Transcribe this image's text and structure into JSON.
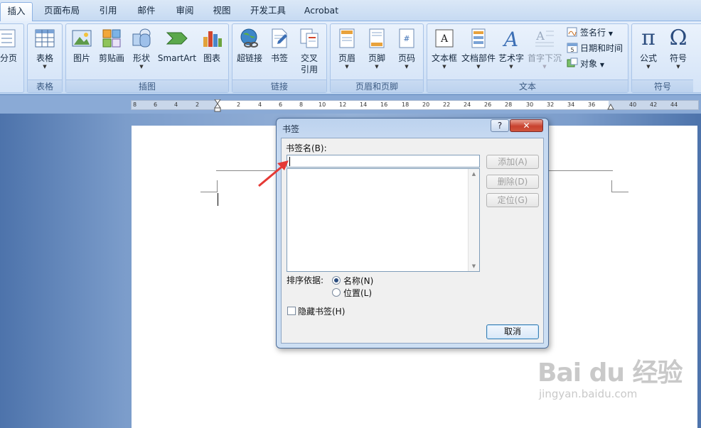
{
  "tabs": [
    {
      "label": "插入",
      "active": true
    },
    {
      "label": "页面布局"
    },
    {
      "label": "引用"
    },
    {
      "label": "邮件"
    },
    {
      "label": "审阅"
    },
    {
      "label": "视图"
    },
    {
      "label": "开发工具"
    },
    {
      "label": "Acrobat"
    }
  ],
  "ribbon": {
    "pages_partial_label": "分页",
    "groups": {
      "table": {
        "label": "表格",
        "buttons": {
          "table": "表格"
        }
      },
      "illustrations": {
        "label": "插图",
        "buttons": {
          "picture": "图片",
          "clipart": "剪贴画",
          "shapes": "形状",
          "smartart": "SmartArt",
          "chart": "图表"
        }
      },
      "links": {
        "label": "链接",
        "buttons": {
          "hyperlink": "超链接",
          "bookmark": "书签",
          "crossref_1": "交叉",
          "crossref_2": "引用"
        }
      },
      "header_footer": {
        "label": "页眉和页脚",
        "buttons": {
          "header": "页眉",
          "footer": "页脚",
          "page_number": "页码"
        }
      },
      "text": {
        "label": "文本",
        "buttons": {
          "textbox": "文本框",
          "quickparts": "文档部件",
          "wordart": "艺术字",
          "dropcap": "首字下沉",
          "signature": "签名行",
          "datetime": "日期和时间",
          "object": "对象"
        }
      },
      "symbols": {
        "label": "符号",
        "buttons": {
          "equation": "公式",
          "symbol": "符号",
          "equation_glyph": "π",
          "symbol_glyph": "Ω"
        }
      }
    }
  },
  "ruler": {
    "ticks": [
      "8",
      "6",
      "4",
      "2",
      "2",
      "4",
      "6",
      "8",
      "10",
      "12",
      "14",
      "16",
      "18",
      "20",
      "22",
      "24",
      "26",
      "28",
      "30",
      "32",
      "34",
      "36",
      "40",
      "42",
      "44"
    ]
  },
  "dialog": {
    "title": "书签",
    "help": "?",
    "close": "✕",
    "name_label": "书签名(B):",
    "name_value": "",
    "buttons": {
      "add": "添加(A)",
      "delete": "删除(D)",
      "goto": "定位(G)",
      "cancel": "取消"
    },
    "sort_label": "排序依据:",
    "sort_options": [
      {
        "label": "名称(N)",
        "selected": true
      },
      {
        "label": "位置(L)",
        "selected": false
      }
    ],
    "hidden_bookmarks": {
      "label": "隐藏书签(H)",
      "checked": false
    }
  },
  "watermark": {
    "logo": "Bai du 经验",
    "site": "jingyan.baidu.com"
  },
  "colors": {
    "accent": "#2b579a",
    "pointer": "#e53935",
    "close_button": "#c8412e"
  }
}
